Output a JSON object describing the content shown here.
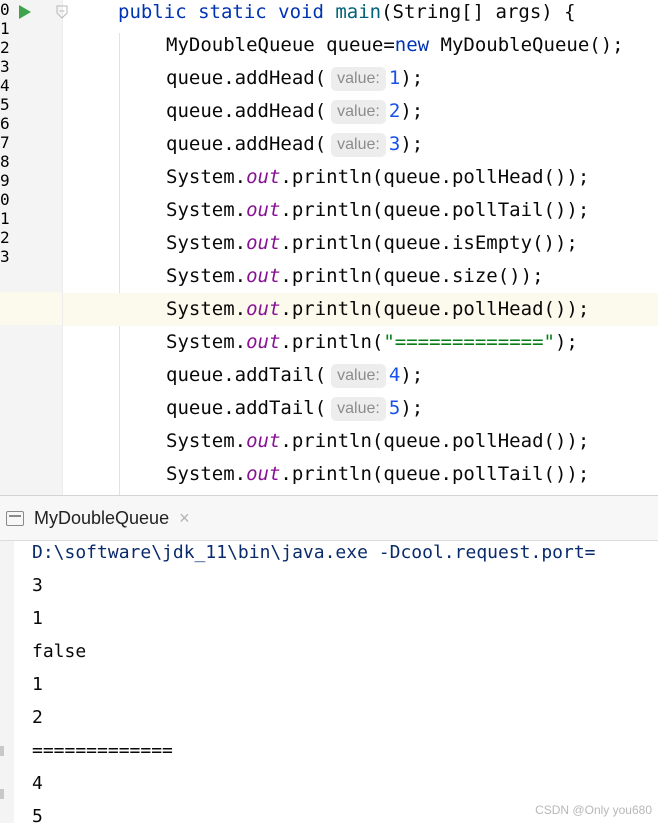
{
  "editor": {
    "gutter_numbers": [
      "0",
      "1",
      "2",
      "3",
      "4",
      "5",
      "6",
      "7",
      "8",
      "9",
      "0",
      "1",
      "2",
      "3"
    ],
    "lines": [
      {
        "type": "main_decl",
        "kw1": "public static void ",
        "name": "main",
        "rest": "(String[] args) {"
      },
      {
        "type": "plain_kw",
        "pre": "MyDoubleQueue queue=",
        "kw": "new",
        "post": " MyDoubleQueue();"
      },
      {
        "type": "call_hint",
        "pre": "queue.addHead(",
        "hint": "value:",
        "num": "1",
        "post": ");"
      },
      {
        "type": "call_hint",
        "pre": "queue.addHead(",
        "hint": "value:",
        "num": "2",
        "post": ");"
      },
      {
        "type": "call_hint",
        "pre": "queue.addHead(",
        "hint": "value:",
        "num": "3",
        "post": ");"
      },
      {
        "type": "println",
        "pre": "System.",
        "field": "out",
        "post": ".println(queue.pollHead());"
      },
      {
        "type": "println",
        "pre": "System.",
        "field": "out",
        "post": ".println(queue.pollTail());"
      },
      {
        "type": "println",
        "pre": "System.",
        "field": "out",
        "post": ".println(queue.isEmpty());"
      },
      {
        "type": "println",
        "pre": "System.",
        "field": "out",
        "post": ".println(queue.size());"
      },
      {
        "type": "println",
        "pre": "System.",
        "field": "out",
        "post": ".println(queue.pollHead());"
      },
      {
        "type": "println_str",
        "pre": "System.",
        "field": "out",
        "mid": ".println(",
        "str": "\"=============\"",
        "post": ");"
      },
      {
        "type": "call_hint",
        "pre": "queue.addTail(",
        "hint": "value:",
        "num": "4",
        "post": ");"
      },
      {
        "type": "call_hint",
        "pre": "queue.addTail(",
        "hint": "value:",
        "num": "5",
        "post": ");"
      },
      {
        "type": "println",
        "pre": "System.",
        "field": "out",
        "post": ".println(queue.pollHead());"
      },
      {
        "type": "println",
        "pre": "System.",
        "field": "out",
        "post": ".println(queue.pollTail());"
      }
    ]
  },
  "run_tab": {
    "label": "MyDoubleQueue",
    "close": "×"
  },
  "console": {
    "command": "D:\\software\\jdk_11\\bin\\java.exe -Dcool.request.port=",
    "output": [
      "3",
      "1",
      "false",
      "1",
      "2",
      "=============",
      "4",
      "5"
    ]
  },
  "watermark": "CSDN @Only you680",
  "colors": {
    "keyword": "#0033b3",
    "method": "#00627a",
    "field": "#871094",
    "number": "#1750eb",
    "string": "#067d17",
    "run_green": "#3fa34d",
    "current_line": "#fcfaed"
  }
}
